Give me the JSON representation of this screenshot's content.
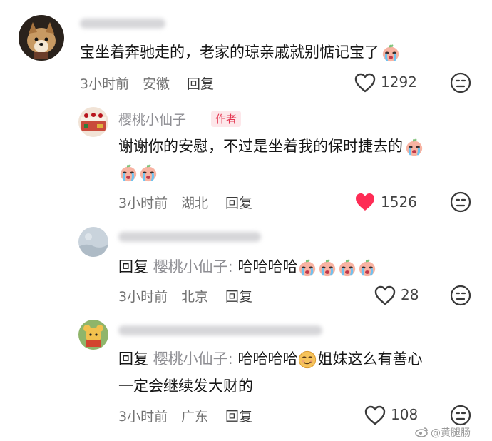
{
  "comments": [
    {
      "username_visible": false,
      "text": "宝坐着奔驰走的，老家的琼亲戚就别惦记宝了",
      "time": "3小时前",
      "location": "安徽",
      "reply_label": "回复",
      "likes": "1292",
      "liked": false
    },
    {
      "username": "樱桃小仙子",
      "badge": "作者",
      "text_line1": "谢谢你的安慰，不过是坐着我的保时捷去的",
      "time": "3小时前",
      "location": "湖北",
      "reply_label": "回复",
      "likes": "1526",
      "liked": true
    },
    {
      "username_visible": false,
      "reply_prefix": "回复",
      "mention": "樱桃小仙子:",
      "text": "哈哈哈哈",
      "time": "3小时前",
      "location": "北京",
      "reply_label": "回复",
      "likes": "28",
      "liked": false
    },
    {
      "username_visible": false,
      "reply_prefix": "回复",
      "mention": "樱桃小仙子:",
      "text_before_emoji": "哈哈哈哈",
      "text_after_emoji": "姐妹这么有善心",
      "text_line2": "一定会继续发大财的",
      "time": "3小时前",
      "location": "广东",
      "reply_label": "回复",
      "likes": "108",
      "liked": false
    }
  ],
  "watermark": "@黄腿肠",
  "colors": {
    "heart_red": "#fe2c55",
    "muted": "#8e8e93",
    "icon_gray": "#3a3a3a"
  },
  "icons": [
    "heart-outline-icon",
    "heart-filled-icon",
    "dislike-face-icon",
    "crying-emoji",
    "smirk-emoji",
    "weibo-logo-icon"
  ]
}
